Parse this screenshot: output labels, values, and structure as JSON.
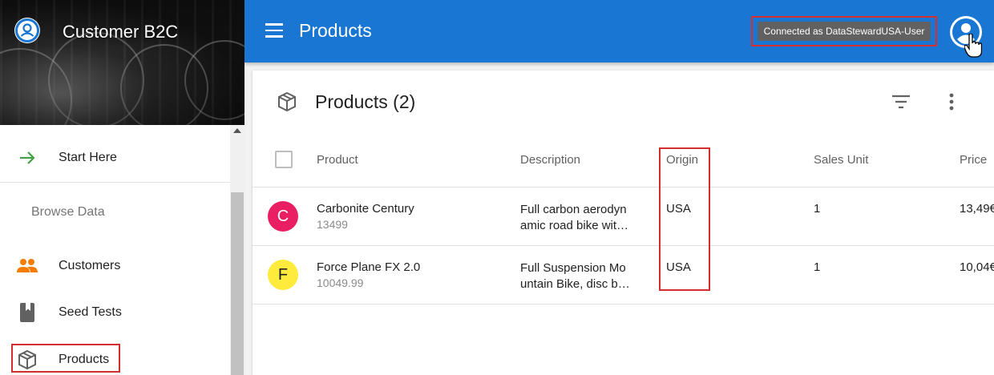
{
  "sidebar": {
    "app_title": "Customer B2C",
    "start_here": "Start Here",
    "section_label": "Browse Data",
    "items": [
      {
        "label": "Customers",
        "icon": "people-icon"
      },
      {
        "label": "Seed Tests",
        "icon": "bookmark-icon"
      },
      {
        "label": "Products",
        "icon": "cube-icon"
      }
    ]
  },
  "appbar": {
    "title": "Products",
    "connected_text": "Connected as DataStewardUSA-User"
  },
  "card": {
    "title": "Products (2)",
    "columns": [
      "Product",
      "Description",
      "Origin",
      "Sales Unit",
      "Price"
    ],
    "rows": [
      {
        "avatar_letter": "C",
        "avatar_color": "#e91e63",
        "avatar_text_color": "#ffffff",
        "name": "Carbonite Century",
        "id": "13499",
        "description": "Full carbon aerodyn amic road bike wit…",
        "origin": "USA",
        "sales_unit": "1",
        "price": "13,49€"
      },
      {
        "avatar_letter": "F",
        "avatar_color": "#ffeb3b",
        "avatar_text_color": "#212121",
        "name": "Force Plane FX 2.0",
        "id": "10049.99",
        "description": "Full Suspension Mo untain Bike, disc b…",
        "origin": "USA",
        "sales_unit": "1",
        "price": "10,04€"
      }
    ]
  },
  "colors": {
    "appbar": "#1976d2",
    "highlight": "#d32f2f",
    "start_arrow": "#43a047",
    "customers_icon": "#f57c00"
  }
}
